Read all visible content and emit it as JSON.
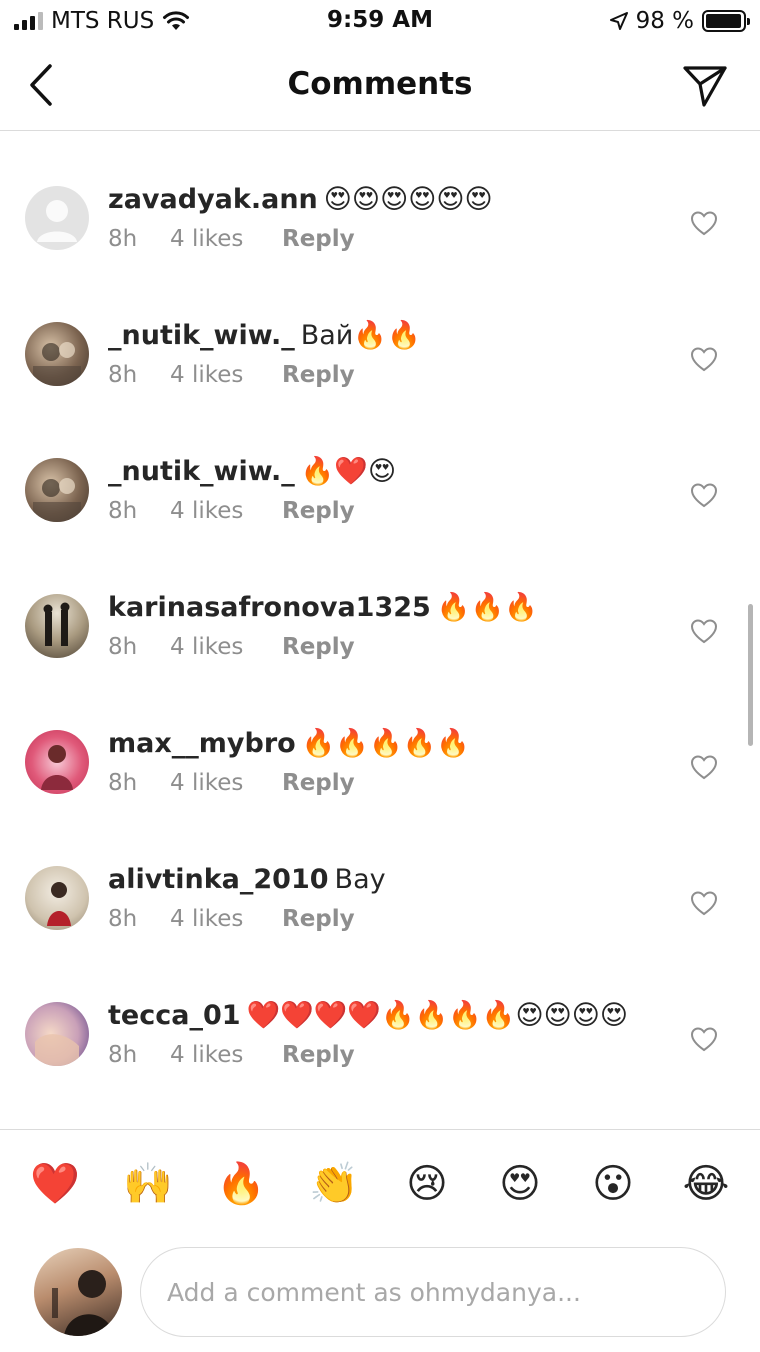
{
  "status_bar": {
    "carrier": "MTS RUS",
    "time": "9:59 AM",
    "battery": "98 %",
    "battery_level": 0.98
  },
  "header": {
    "title": "Comments"
  },
  "comments": [
    {
      "user": "zavadyak.ann",
      "text": "😍😍😍😍😍😍",
      "time": "8h",
      "likes": "4 likes",
      "reply": "Reply"
    },
    {
      "user": "_nutik_wiw._",
      "text": "Вай🔥🔥",
      "time": "8h",
      "likes": "4 likes",
      "reply": "Reply"
    },
    {
      "user": "_nutik_wiw._",
      "text": "🔥❤️😍",
      "time": "8h",
      "likes": "4 likes",
      "reply": "Reply"
    },
    {
      "user": "karinasafronova1325",
      "text": "🔥🔥🔥",
      "time": "8h",
      "likes": "4 likes",
      "reply": "Reply"
    },
    {
      "user": "max__mybro",
      "text": "🔥🔥🔥🔥🔥",
      "time": "8h",
      "likes": "4 likes",
      "reply": "Reply"
    },
    {
      "user": "alivtinka_2010",
      "text": "Bay",
      "time": "8h",
      "likes": "4 likes",
      "reply": "Reply"
    },
    {
      "user": "tecca_01",
      "text": "❤️❤️❤️❤️🔥🔥🔥🔥😍😍😍😍",
      "time": "8h",
      "likes": "4 likes",
      "reply": "Reply"
    }
  ],
  "quick_emojis": [
    "❤️",
    "🙌",
    "🔥",
    "👏",
    "😢",
    "😍",
    "😮",
    "😂"
  ],
  "composer": {
    "placeholder": "Add a comment as ohmydanya..."
  },
  "icons": {
    "back": "chevron-left-icon",
    "send": "paper-plane-icon",
    "like": "heart-outline-icon"
  },
  "colors": {
    "text": "#262626",
    "secondary_text": "#8e8e8e",
    "divider": "#dbdbdb"
  }
}
